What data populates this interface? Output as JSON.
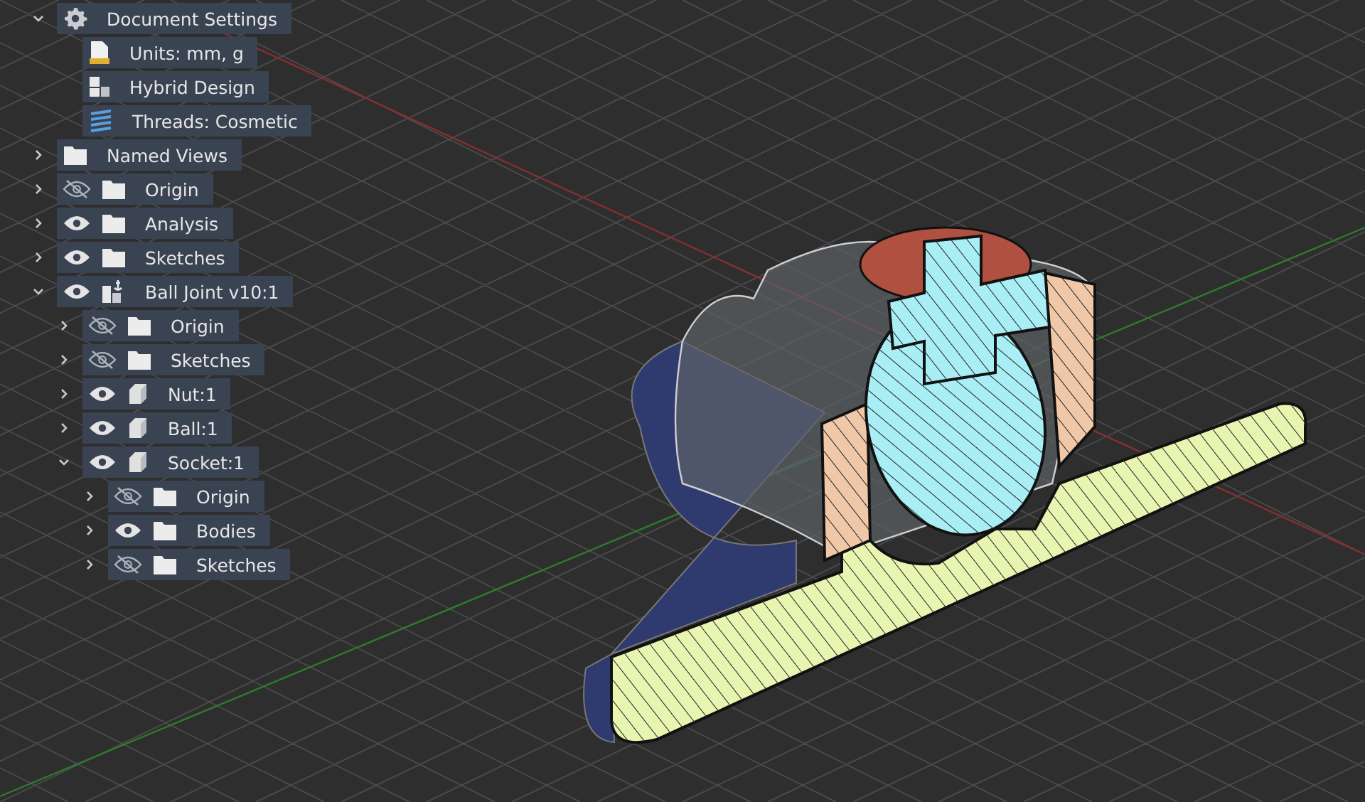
{
  "tree": [
    {
      "label": "Document Settings",
      "kind": "settings",
      "expanded": true,
      "children": [
        {
          "label": "Units: mm, g",
          "kind": "units"
        },
        {
          "label": "Hybrid Design",
          "kind": "design"
        },
        {
          "label": "Threads: Cosmetic",
          "kind": "threads"
        }
      ]
    },
    {
      "label": "Named Views",
      "kind": "folder",
      "expanded": false
    },
    {
      "label": "Origin",
      "kind": "folder",
      "expanded": false,
      "visible": false
    },
    {
      "label": "Analysis",
      "kind": "folder",
      "expanded": false,
      "visible": true
    },
    {
      "label": "Sketches",
      "kind": "folder",
      "expanded": false,
      "visible": true
    },
    {
      "label": "Ball Joint v10:1",
      "kind": "assembly",
      "expanded": true,
      "visible": true,
      "children": [
        {
          "label": "Origin",
          "kind": "folder",
          "expanded": false,
          "visible": false
        },
        {
          "label": "Sketches",
          "kind": "folder",
          "expanded": false,
          "visible": false
        },
        {
          "label": "Nut:1",
          "kind": "component",
          "expanded": false,
          "visible": true
        },
        {
          "label": "Ball:1",
          "kind": "component",
          "expanded": false,
          "visible": true
        },
        {
          "label": "Socket:1",
          "kind": "component",
          "expanded": true,
          "visible": true,
          "children": [
            {
              "label": "Origin",
              "kind": "folder",
              "expanded": false,
              "visible": false
            },
            {
              "label": "Bodies",
              "kind": "folder",
              "expanded": false,
              "visible": true
            },
            {
              "label": "Sketches",
              "kind": "folder",
              "expanded": false,
              "visible": false
            }
          ]
        }
      ]
    }
  ]
}
